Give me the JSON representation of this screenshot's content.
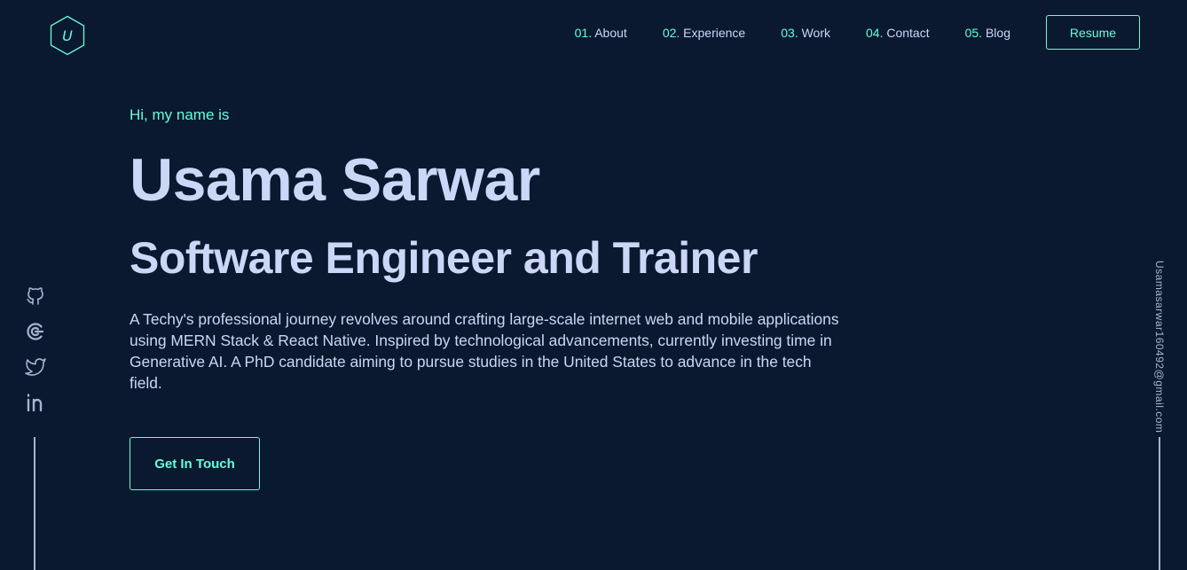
{
  "logo": {
    "letter": "U",
    "icon": "hexagon-logo-icon"
  },
  "nav": {
    "items": [
      {
        "num": "01.",
        "label": "About"
      },
      {
        "num": "02.",
        "label": "Experience"
      },
      {
        "num": "03.",
        "label": "Work"
      },
      {
        "num": "04.",
        "label": "Contact"
      },
      {
        "num": "05.",
        "label": "Blog"
      }
    ],
    "resume_label": "Resume"
  },
  "hero": {
    "greeting": "Hi, my name is",
    "name": "Usama Sarwar",
    "subtitle": "Software Engineer and Trainer",
    "description": "A Techy's professional journey revolves around crafting large-scale internet web and mobile applications using MERN Stack & React Native. Inspired by technological advancements, currently investing time in Generative AI. A PhD candidate aiming to pursue studies in the United States to advance in the tech field.",
    "cta_label": "Get In Touch"
  },
  "social": {
    "icons": [
      "github-icon",
      "codersrank-icon",
      "twitter-icon",
      "linkedin-icon"
    ]
  },
  "email": {
    "address": "Usamasarwar160492@gmail.com"
  },
  "colors": {
    "background": "#0a192f",
    "accent": "#64ffda",
    "text_primary": "#ccd6f6",
    "text_secondary": "#a8b2d1"
  }
}
